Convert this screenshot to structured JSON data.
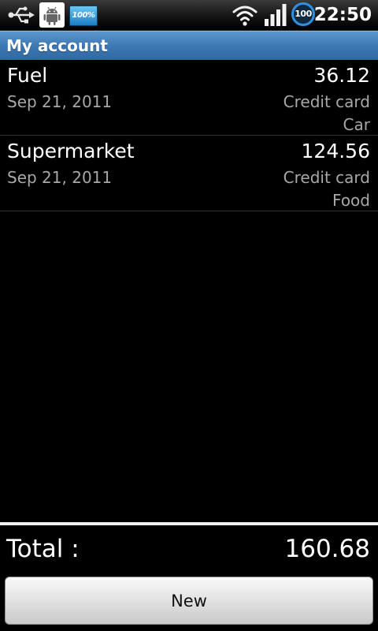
{
  "status_bar": {
    "icons": [
      "usb-icon",
      "android-debug-icon",
      "battery-notification-icon",
      "wifi-icon",
      "signal-icon",
      "battery-icon"
    ],
    "battery_notification_text": "100%",
    "battery_level_text": "100",
    "time": "22:50"
  },
  "header": {
    "title": "My account"
  },
  "transactions": [
    {
      "name": "Fuel",
      "amount": "36.12",
      "date": "Sep 21, 2011",
      "payment_method": "Credit card",
      "category": "Car"
    },
    {
      "name": "Supermarket",
      "amount": "124.56",
      "date": "Sep 21, 2011",
      "payment_method": "Credit card",
      "category": "Food"
    }
  ],
  "footer": {
    "total_label": "Total :",
    "total_value": "160.68",
    "new_button_label": "New"
  },
  "colors": {
    "title_bar": "#3f79b5",
    "secondary_text": "#a8a8a8",
    "background": "#000000"
  }
}
